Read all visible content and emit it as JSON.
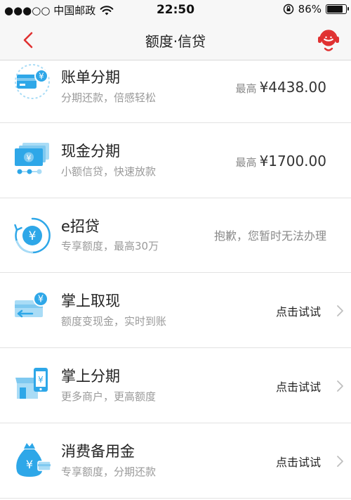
{
  "status_bar": {
    "carrier": "●●●○○ 中国邮政",
    "time": "22:50",
    "battery": "86%",
    "battery_level": 0.86,
    "icons": [
      "wifi-icon",
      "orientation-lock-icon",
      "battery-icon"
    ]
  },
  "nav": {
    "title": "额度·信贷",
    "icons": [
      "back-chevron-icon",
      "customer-service-icon"
    ],
    "accent_color": "#e03131"
  },
  "items": [
    {
      "title": "账单分期",
      "subtitle": "分期还款，倍感轻松",
      "right_prefix": "最高",
      "right_value": "¥4438.00",
      "icon": "bill-installment-icon"
    },
    {
      "title": "现金分期",
      "subtitle": "小额信贷，快速放款",
      "right_prefix": "最高",
      "right_value": "¥1700.00",
      "icon": "cash-installment-icon"
    },
    {
      "title": "e招贷",
      "subtitle": "专享额度，最高30万",
      "right_text": "抱歉，您暂时无法办理",
      "icon": "e-loan-icon"
    },
    {
      "title": "掌上取现",
      "subtitle": "额度变现金，实时到账",
      "right_text": "点击试试",
      "icon": "mobile-cash-icon"
    },
    {
      "title": "掌上分期",
      "subtitle": "更多商户，更高额度",
      "right_text": "点击试试",
      "icon": "mobile-installment-icon"
    },
    {
      "title": "消费备用金",
      "subtitle": "专享额度，分期还款",
      "right_text": "点击试试",
      "icon": "consumer-reserve-icon"
    }
  ],
  "colors": {
    "icon_blue": "#2ea7e8",
    "icon_light_blue": "#a9dcf6",
    "divider": "#e2e2e2",
    "subtitle": "#9a9a9a"
  }
}
